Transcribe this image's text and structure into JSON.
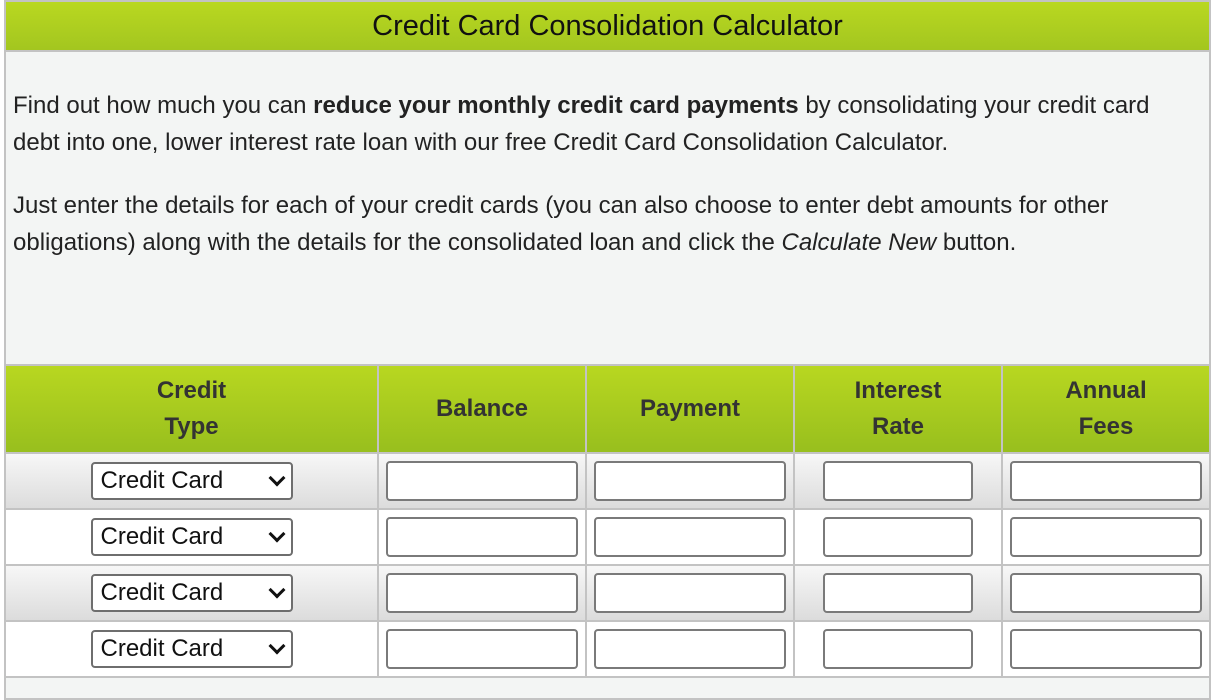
{
  "title": "Credit Card Consolidation Calculator",
  "intro": {
    "p1_pre": "Find out how much you can ",
    "p1_bold": "reduce your monthly credit card payments",
    "p1_post": " by consolidating your credit card debt into one, lower interest rate loan with our free Credit Card Consolidation Calculator.",
    "p2_pre": "Just enter the details for each of your credit cards (you can also choose to enter debt amounts for other obligations) along with the details for the consolidated loan and click the ",
    "p2_italic": "Calculate New",
    "p2_post": " button."
  },
  "table": {
    "headers": {
      "type_line1": "Credit",
      "type_line2": "Type",
      "balance": "Balance",
      "payment": "Payment",
      "rate_line1": "Interest",
      "rate_line2": "Rate",
      "fees_line1": "Annual",
      "fees_line2": "Fees"
    },
    "rows": [
      {
        "type": "Credit Card",
        "balance": "",
        "payment": "",
        "rate": "",
        "fees": ""
      },
      {
        "type": "Credit Card",
        "balance": "",
        "payment": "",
        "rate": "",
        "fees": ""
      },
      {
        "type": "Credit Card",
        "balance": "",
        "payment": "",
        "rate": "",
        "fees": ""
      },
      {
        "type": "Credit Card",
        "balance": "",
        "payment": "",
        "rate": "",
        "fees": ""
      }
    ]
  }
}
